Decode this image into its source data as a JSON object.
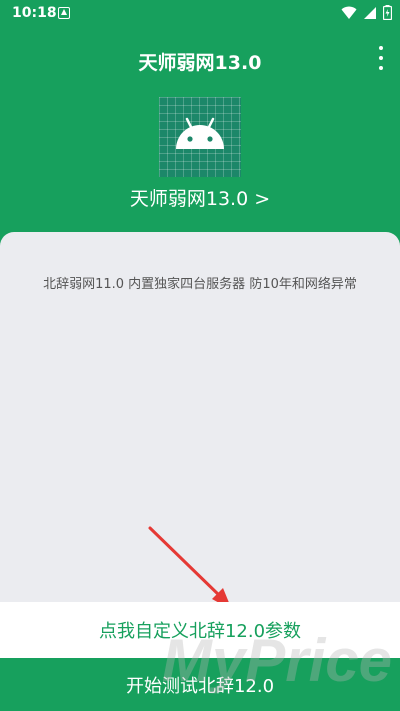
{
  "status_bar": {
    "time": "10:18"
  },
  "app_bar": {
    "title": "天师弱网13.0"
  },
  "app": {
    "name": "天师弱网13.0 >"
  },
  "panel": {
    "notice": "北辞弱网11.0 内置独家四台服务器 防10年和网络异常"
  },
  "buttons": {
    "custom": "点我自定义北辞12.0参数",
    "start": "开始测试北辞12.0"
  },
  "watermark": "MyPrice",
  "colors": {
    "primary": "#17a05d",
    "panel": "#ebecf0",
    "arrow": "#e53935"
  }
}
